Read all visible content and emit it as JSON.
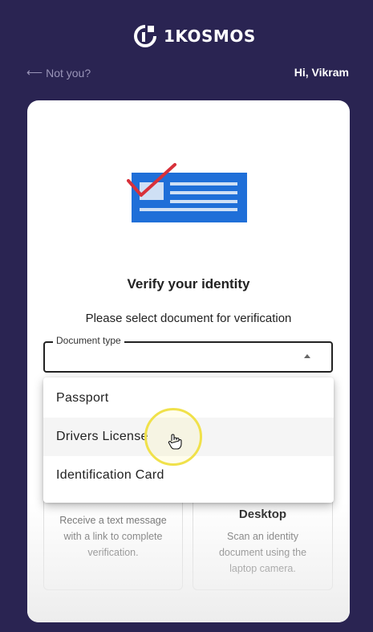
{
  "header": {
    "brand": "1KOSMOS"
  },
  "topbar": {
    "back_label": "Not you?",
    "greeting": "Hi, Vikram"
  },
  "card": {
    "title": "Verify your identity",
    "subtitle": "Please select document for verification",
    "document_select": {
      "legend": "Document type",
      "value": ""
    },
    "options": [
      {
        "title": "",
        "description": "Receive a text message with a link to complete verification."
      },
      {
        "title": "Desktop",
        "description": "Scan an identity document using the laptop camera."
      }
    ]
  },
  "dropdown": {
    "items": [
      "Passport",
      "Drivers License",
      "Identification Card"
    ],
    "hovered_index": 1
  },
  "colors": {
    "background": "#2a2452",
    "card": "#ffffff",
    "id_card_blue": "#1f6fd8",
    "check_red": "#d8313a",
    "cursor_ring": "#f0e14a"
  }
}
